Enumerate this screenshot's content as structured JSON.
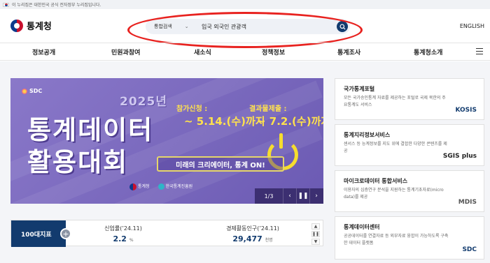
{
  "gov_strip": {
    "text": "이 누리집은 대한민국 공식 전자정부 누리집입니다."
  },
  "header": {
    "logo_text": "통계청",
    "search": {
      "category": "통합검색",
      "value": "입국 외국인 관광객"
    },
    "language": "ENGLISH"
  },
  "nav": {
    "items": [
      "정보공개",
      "민원과참여",
      "새소식",
      "정책정보",
      "통계조사",
      "통계청소개"
    ]
  },
  "banner": {
    "brand": "SDC",
    "year": "2025년",
    "title_line1": "통계데이터",
    "title_line2": "활용대회",
    "apply_label": "참가신청 :",
    "apply_date": "~ 5.14.(수)까지",
    "submit_label": "결과물제출 :",
    "submit_date": "~ 7.2.(수)까지",
    "slogan": "미래의 크리에이터, 통계 ON!",
    "org1": "통계청",
    "org2": "한국통계진흥원",
    "page": "1/3"
  },
  "stats": {
    "label": "100대지표",
    "items": [
      {
        "title": "신업률(’24.11)",
        "value": "2.2",
        "unit": "%"
      },
      {
        "title": "경제활동인구(’24.11)",
        "value": "29,477",
        "unit": "천명"
      }
    ]
  },
  "services": [
    {
      "title": "국가통계포털",
      "desc": "모든 국가승인통계 자료를 제공하는 포털로 국제 북한의 주요통계도 서비스",
      "logo": "KOSIS"
    },
    {
      "title": "통계지리정보서비스",
      "desc": "센서스 등 능계정보를 지도 위에 결합한 다양한 콘텐츠를 제공",
      "logo": "SGIS plus"
    },
    {
      "title": "마이크로데이터 통합서비스",
      "desc": "이용자의 심층연구 분석을 지원하는 통계기초자료(micro data)를 제공",
      "logo": "MDIS"
    },
    {
      "title": "통계데이터센터",
      "desc": "공공데이터를 연결자료 등 외부자료 융합이 가능하도록 구축한 데이터 플랫폼",
      "logo": "SDC"
    }
  ]
}
